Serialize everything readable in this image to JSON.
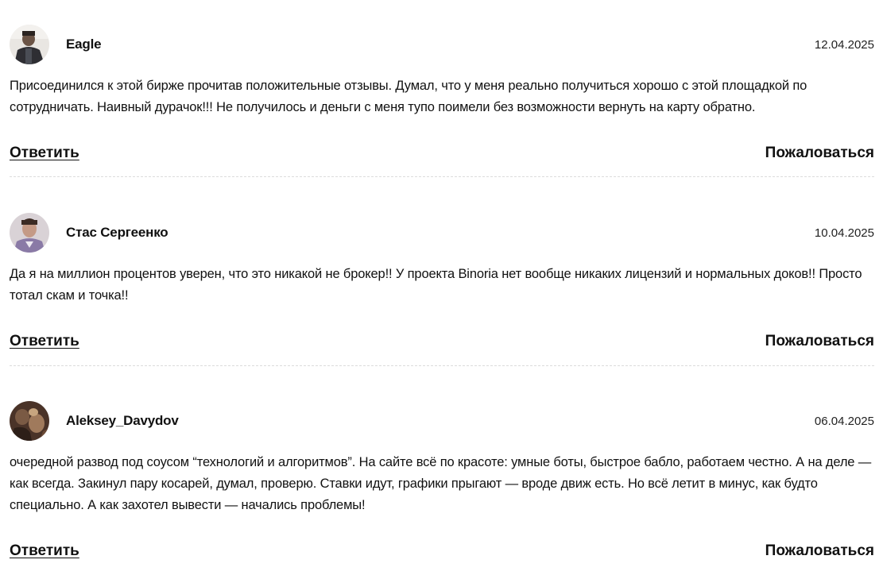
{
  "comments": [
    {
      "author": "Eagle",
      "date": "12.04.2025",
      "text": "Присоединился к этой бирже прочитав положительные отзывы. Думал, что у меня реально получиться хорошо с этой площадкой по сотрудничать. Наивный дурачок!!! Не получилось и деньги с меня тупо поимели без возможности вернуть на карту обратно.",
      "reply_label": "Ответить",
      "report_label": "Пожаловаться"
    },
    {
      "author": "Стас Сергеенко",
      "date": "10.04.2025",
      "text": "Да я на миллион процентов уверен, что это никакой не брокер!! У проекта Binoria нет вообще никаких лицензий и нормальных доков!! Просто тотал скам и точка!!",
      "reply_label": "Ответить",
      "report_label": "Пожаловаться"
    },
    {
      "author": "Aleksey_Davydov",
      "date": "06.04.2025",
      "text": "очередной развод под соусом “технологий и алгоритмов”. На сайте всё по красоте: умные боты, быстрое бабло, работаем честно. А на деле — как всегда. Закинул пару косарей, думал, проверю. Ставки идут, графики прыгают — вроде движ есть. Но всё летит в минус, как будто специально. А как захотел вывести — начались проблемы!",
      "reply_label": "Ответить",
      "report_label": "Пожаловаться"
    }
  ]
}
